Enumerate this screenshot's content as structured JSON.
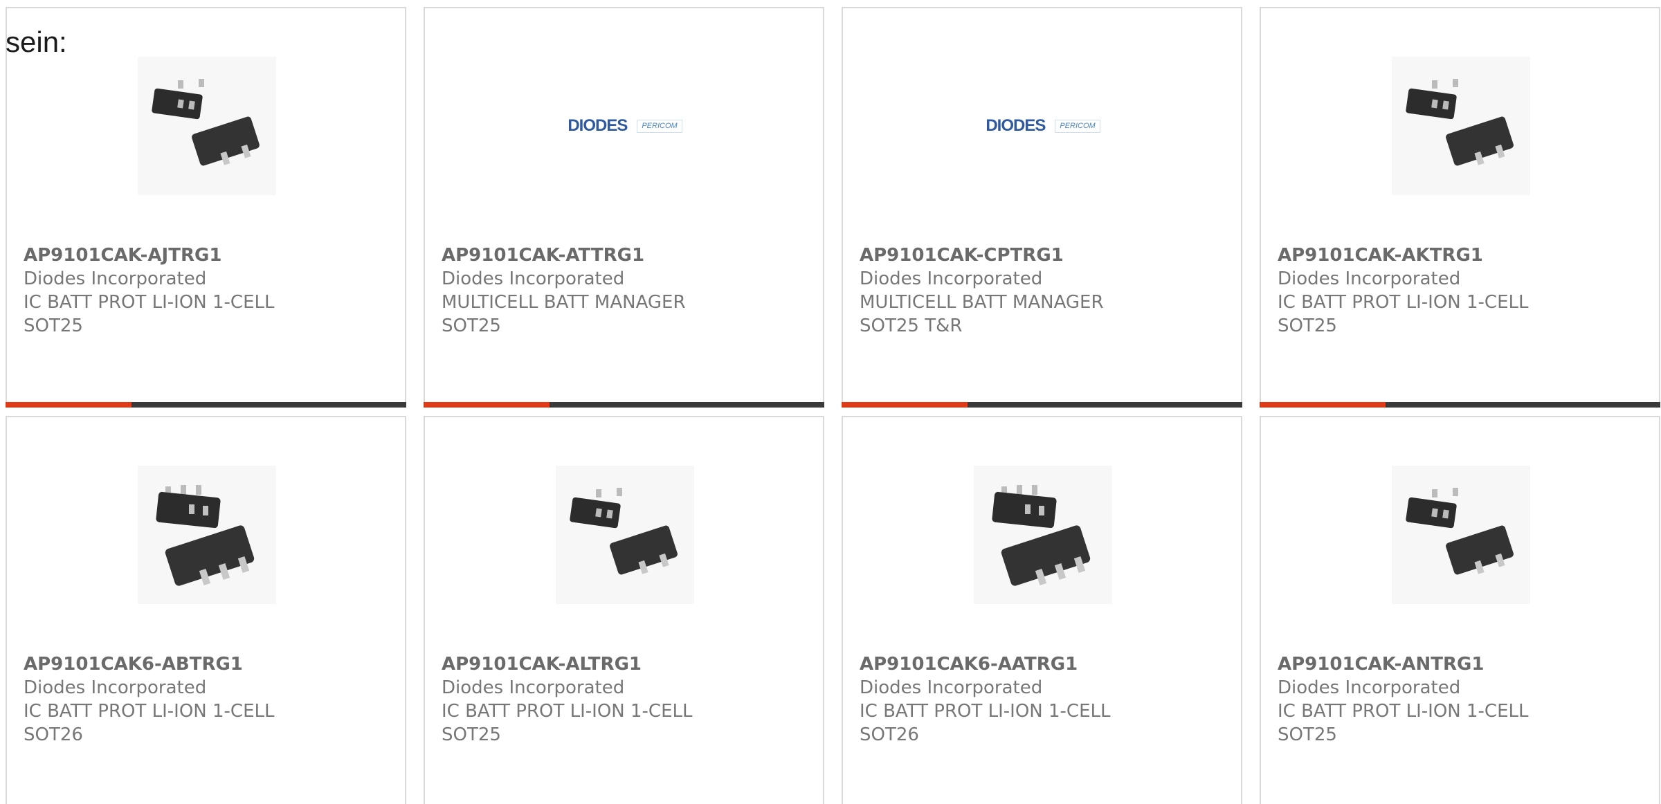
{
  "intro_text": "sein:",
  "colors": {
    "accent": "#e03a16",
    "bar_dark": "#3a3a3a",
    "text_gray": "#777777",
    "border": "#d9d9d9"
  },
  "products": [
    {
      "part": "AP9101CAK-AJTRG1",
      "manufacturer": "Diodes Incorporated",
      "description": "IC BATT PROT LI-ION 1-CELL",
      "package": "SOT25",
      "image": "sot25-chip-photo"
    },
    {
      "part": "AP9101CAK-ATTRG1",
      "manufacturer": "Diodes Incorporated",
      "description": "MULTICELL BATT MANAGER",
      "package": "SOT25",
      "image": "diodes-pericom-logo",
      "logo": {
        "brand": "DIODES",
        "sub": "PERICOM"
      }
    },
    {
      "part": "AP9101CAK-CPTRG1",
      "manufacturer": "Diodes Incorporated",
      "description": "MULTICELL BATT MANAGER",
      "package": "SOT25 T&R",
      "image": "diodes-pericom-logo",
      "logo": {
        "brand": "DIODES",
        "sub": "PERICOM"
      }
    },
    {
      "part": "AP9101CAK-AKTRG1",
      "manufacturer": "Diodes Incorporated",
      "description": "IC BATT PROT LI-ION 1-CELL",
      "package": "SOT25",
      "image": "sot25-chip-photo"
    },
    {
      "part": "AP9101CAK6-ABTRG1",
      "manufacturer": "Diodes Incorporated",
      "description": "IC BATT PROT LI-ION 1-CELL",
      "package": "SOT26",
      "image": "sot26-chip-photo"
    },
    {
      "part": "AP9101CAK-ALTRG1",
      "manufacturer": "Diodes Incorporated",
      "description": "IC BATT PROT LI-ION 1-CELL",
      "package": "SOT25",
      "image": "sot25-chip-photo"
    },
    {
      "part": "AP9101CAK6-AATRG1",
      "manufacturer": "Diodes Incorporated",
      "description": "IC BATT PROT LI-ION 1-CELL",
      "package": "SOT26",
      "image": "sot26-chip-photo"
    },
    {
      "part": "AP9101CAK-ANTRG1",
      "manufacturer": "Diodes Incorporated",
      "description": "IC BATT PROT LI-ION 1-CELL",
      "package": "SOT25",
      "image": "sot25-chip-photo"
    }
  ]
}
